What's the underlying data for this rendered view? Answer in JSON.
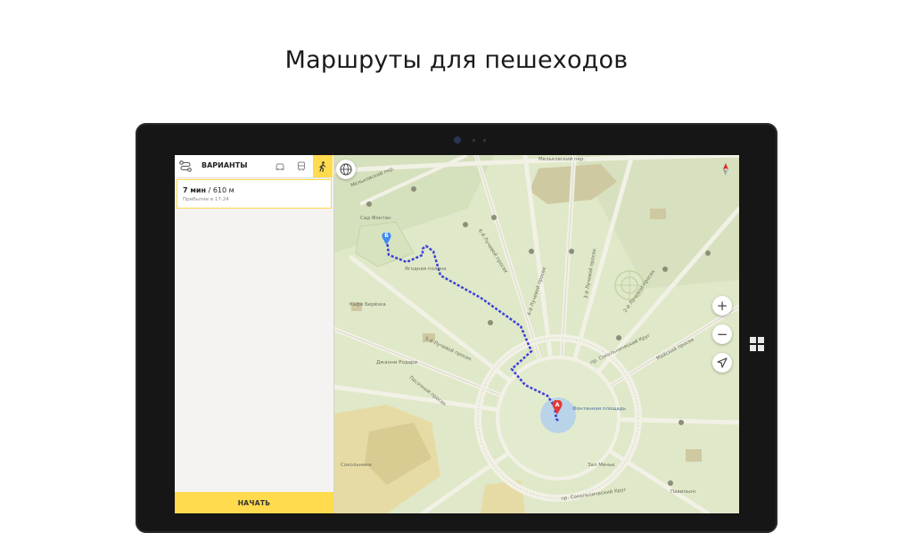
{
  "headline": "Маршруты для пешеходов",
  "panel": {
    "title": "ВАРИАНТЫ",
    "modes": [
      "car",
      "transit",
      "walk"
    ],
    "active_mode": "walk",
    "route": {
      "time": "7 мин",
      "separator": " / ",
      "distance": "610 м",
      "arrival": "Прибытие в 17:24"
    },
    "start_label": "НАЧАТЬ"
  },
  "map": {
    "zoom_in": "+",
    "zoom_out": "−",
    "markers": {
      "start": "Б",
      "end": "А"
    },
    "labels": {
      "street_top": "Мельковский пер.",
      "street_left": "Мельковский пер.",
      "street_1": "4-й Лучевой просек",
      "street_2": "3-й Лучевой просек",
      "street_3": "5-й Лучевой просек",
      "street_4": "2-й Лучевой просек",
      "street_5": "6-й Лучевой просек",
      "street_6": "Майский просек",
      "street_7": "Песочный просек",
      "street_8": "пр. Сокольнический Круг",
      "street_9": "пр. Сокольнический Круг",
      "poi_fountain": "Фонтанная площадь",
      "poi_garden": "Сад Фонтан",
      "poi_berry": "Ягодная поляна",
      "poi_cafe": "Кафе Берёзка",
      "poi_park": "Джанни Родари",
      "poi_sport": "Сокольники",
      "poi_hall": "Зал Менье",
      "poi_pavilion": "Павильон"
    }
  },
  "colors": {
    "accent": "#ffdb4d",
    "route": "#3d3fdb",
    "map_bg": "#dfe8c8",
    "marker_a": "#e53935",
    "marker_b": "#3d8bf5"
  }
}
